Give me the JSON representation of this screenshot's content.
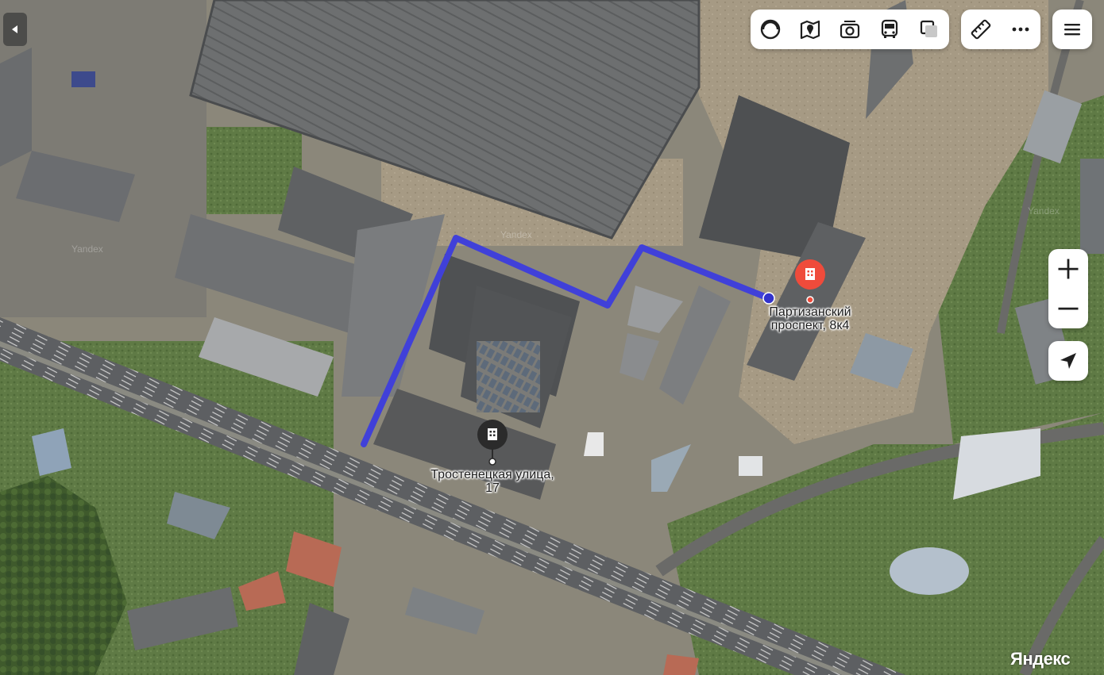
{
  "map": {
    "type": "satellite",
    "brand": "Яндекс",
    "watermark": "Yandex",
    "colors": {
      "route": "#4040d9",
      "destination_pin": "#ef4b3b",
      "origin_pin": "#2b2b2b"
    }
  },
  "route": {
    "start": {
      "label": "Тростенецкая улица, 17",
      "label_lines": [
        "Тростенецкая улица,",
        "17"
      ],
      "icon": "building-icon"
    },
    "end": {
      "label": "Партизанский проспект, 8к4",
      "label_lines": [
        "Партизанский",
        "проспект, 8к4"
      ],
      "icon": "building-icon"
    }
  },
  "controls": {
    "layers": [
      {
        "name": "panorama",
        "icon": "panorama-icon"
      },
      {
        "name": "map-layers",
        "icon": "map-layers-icon"
      },
      {
        "name": "photos",
        "icon": "camera-icon"
      },
      {
        "name": "transit",
        "icon": "bus-icon"
      },
      {
        "name": "layer-type",
        "icon": "layers-icon"
      }
    ],
    "tools": [
      {
        "name": "ruler",
        "icon": "ruler-icon"
      },
      {
        "name": "more",
        "icon": "more-icon"
      }
    ],
    "menu": {
      "icon": "hamburger-icon"
    },
    "zoom_in": {
      "icon": "plus-icon"
    },
    "zoom_out": {
      "icon": "minus-icon"
    },
    "locate": {
      "icon": "navigation-arrow-icon"
    },
    "collapse": {
      "icon": "chevron-left-icon"
    }
  }
}
